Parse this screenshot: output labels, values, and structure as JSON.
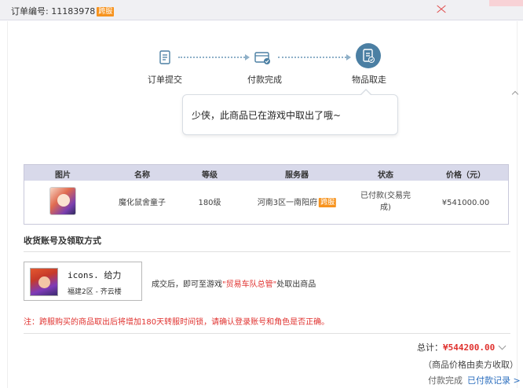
{
  "header": {
    "order_label": "订单编号: 11183978",
    "order_tag": "跨服"
  },
  "steps": [
    {
      "label": "订单提交",
      "icon": "document-icon"
    },
    {
      "label": "付款完成",
      "icon": "card-check-icon"
    },
    {
      "label": "物品取走",
      "icon": "document-check-icon"
    }
  ],
  "bubble_text": "少侠，此商品已在游戏中取出了哦~",
  "table": {
    "headers": [
      "图片",
      "名称",
      "等级",
      "服务器",
      "状态",
      "价格（元）"
    ],
    "row": {
      "name": "魔化鼠舍童子",
      "level": "180级",
      "server": "河南3区一南阳府",
      "server_tag": "跨服",
      "status_line1": "已付款(交易完",
      "status_line2": "成)",
      "price": "¥541000.00"
    }
  },
  "section": {
    "title": "收货账号及领取方式"
  },
  "account": {
    "name": "icons. 给力",
    "server": "福建2区 - 齐云楼"
  },
  "pickup": {
    "prefix": "成交后，即可至游戏",
    "highlight": "\"贸易车队总管\"",
    "suffix": "处取出商品"
  },
  "notice": "注：跨服购买的商品取出后将增加180天转服时间锁，请确认登录账号和角色是否正确。",
  "summary": {
    "total_label": "总计：",
    "total_value": "¥544200.00",
    "price_note": "（商品价格由卖方收取）",
    "pay_label": "付款完成",
    "pay_link": "已付款记录 >"
  },
  "colors": {
    "accent": "#4b7fa3",
    "highlight": "#e0322f",
    "tag": "#f7931e",
    "link": "#2d6fbf"
  }
}
